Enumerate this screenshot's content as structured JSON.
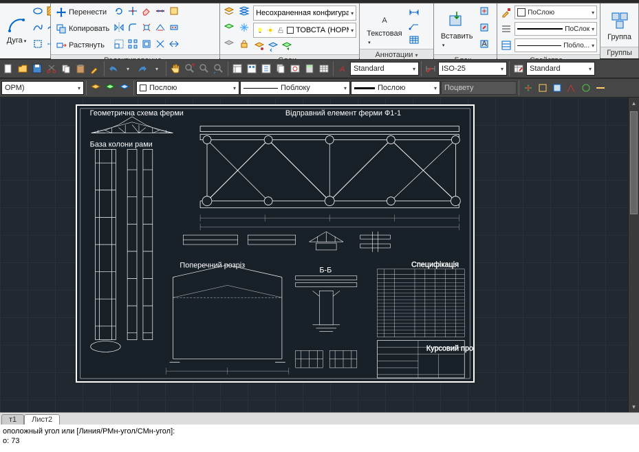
{
  "ribbon": {
    "arc_label": "Дуга",
    "move_label": "Перенести",
    "copy_label": "Копировать",
    "stretch_label": "Растянуть",
    "edit_panel": "Редактирование",
    "layer_config": "Несохраненная конфигурация сло",
    "layer_current": "ТОВСТА (НОРМ)",
    "layers_panel": "Слои",
    "text_label": "Текстовая",
    "annot_panel": "Аннотации",
    "insert_label": "Вставить",
    "block_panel": "Блок",
    "bylayer": "ПоСлою",
    "bylayer2": "ПоСлок",
    "byblock": "Побло...",
    "props_panel": "Свойства",
    "group_label": "Группа",
    "groups_panel": "Группы"
  },
  "toolbar1": {
    "style1": "Standard",
    "dimstyle": "ISO-25",
    "tblstyle": "Standard"
  },
  "toolbar2": {
    "layer_dd": "ОРМ)",
    "color_dd": "Послою",
    "lt_dd": "Поблоку",
    "lw_dd": "Послою",
    "plot_dd": "Поцвету"
  },
  "drawing": {
    "t1": "Геометрична схема ферми",
    "t2": "Відправний елемент ферми Ф1-1",
    "t3": "Поперечний розріз",
    "t4": "База колони рами",
    "t5": "Специфікація",
    "t6": "Курсовий проект",
    "t7": "Б-Б"
  },
  "tabs": {
    "t1": "т1",
    "t2": "Лист2"
  },
  "cmd": {
    "line1": "оположный угол или [Линия/РМн-угол/СМн-угол]:",
    "line2": "о: 73"
  }
}
